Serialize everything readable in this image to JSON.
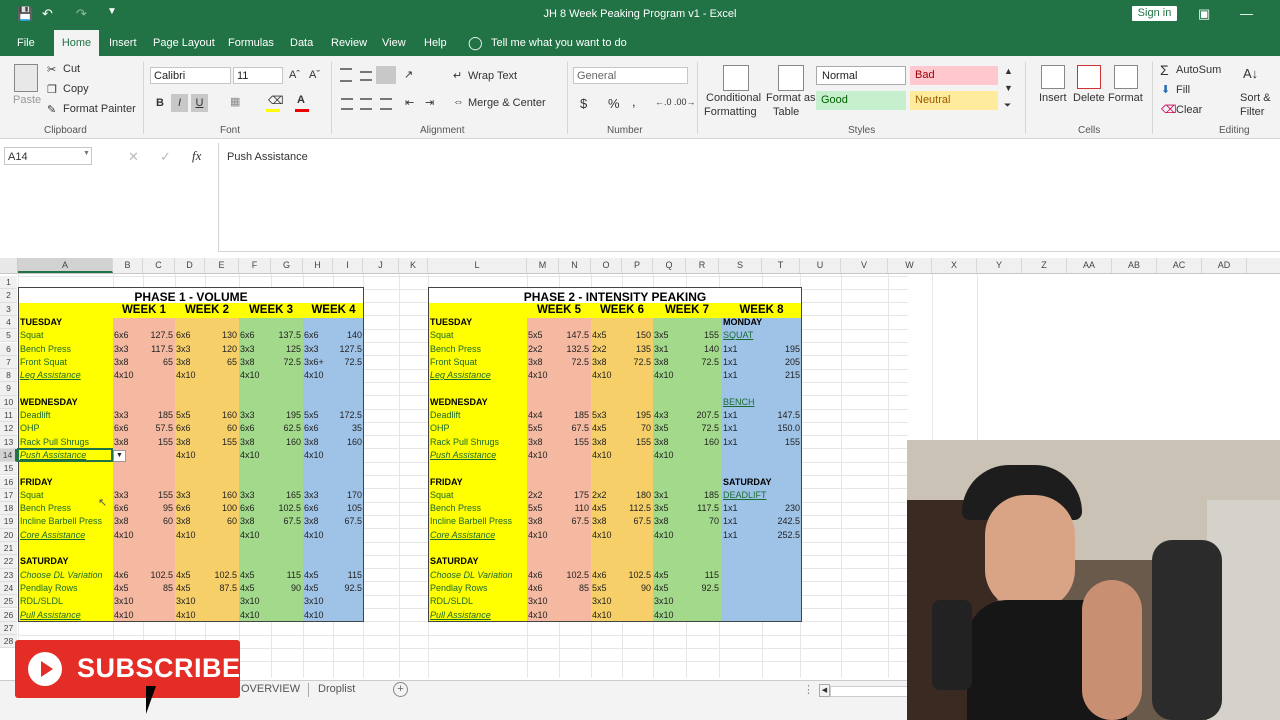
{
  "window": {
    "title": "JH 8 Week Peaking Program v1  -  Excel",
    "sign_in": "Sign in"
  },
  "menu": {
    "items": [
      "File",
      "Home",
      "Insert",
      "Page Layout",
      "Formulas",
      "Data",
      "Review",
      "View",
      "Help"
    ],
    "active": "Home",
    "tell_me": "Tell me what you want to do"
  },
  "ribbon": {
    "clipboard": {
      "paste": "Paste",
      "cut": "Cut",
      "copy": "Copy",
      "format_painter": "Format Painter",
      "label": "Clipboard"
    },
    "font": {
      "name": "Calibri",
      "size": "11",
      "bold": "B",
      "italic": "I",
      "underline": "U",
      "label": "Font"
    },
    "alignment": {
      "wrap": "Wrap Text",
      "merge": "Merge & Center",
      "label": "Alignment"
    },
    "number": {
      "format": "General",
      "currency": "$",
      "percent": "%",
      "comma": ",",
      "label": "Number"
    },
    "styles": {
      "conditional": "Conditional",
      "formatting": "Formatting",
      "format_as": "Format as",
      "table": "Table",
      "normal": "Normal",
      "bad": "Bad",
      "good": "Good",
      "neutral": "Neutral",
      "label": "Styles"
    },
    "cells": {
      "insert": "Insert",
      "delete": "Delete",
      "format": "Format",
      "label": "Cells"
    },
    "editing": {
      "autosum": "AutoSum",
      "fill": "Fill",
      "clear": "Clear",
      "sort": "Sort &",
      "filter": "Filter",
      "label": "Editing"
    }
  },
  "formula_bar": {
    "name_box": "A14",
    "fx": "fx",
    "content": "Push Assistance"
  },
  "columns": [
    "A",
    "B",
    "C",
    "D",
    "E",
    "F",
    "G",
    "H",
    "I",
    "J",
    "K",
    "L",
    "M",
    "N",
    "O",
    "P",
    "Q",
    "R",
    "S",
    "T",
    "U",
    "V",
    "W",
    "X",
    "Y",
    "Z",
    "AA",
    "AB",
    "AC",
    "AD",
    "AE"
  ],
  "rows": [
    "1",
    "2",
    "3",
    "4",
    "5",
    "6",
    "7",
    "8",
    "9",
    "10",
    "11",
    "12",
    "13",
    "14",
    "15",
    "16",
    "17",
    "18",
    "19",
    "20",
    "21",
    "22",
    "23",
    "24",
    "25",
    "26",
    "27",
    "28"
  ],
  "phase1": {
    "title": "PHASE 1 - VOLUME",
    "weeks": [
      "WEEK 1",
      "WEEK 2",
      "WEEK 3",
      "WEEK 4"
    ],
    "rows": [
      {
        "r": 4,
        "label": "TUESDAY",
        "style": "bold",
        "vals": []
      },
      {
        "r": 5,
        "label": "Squat",
        "vals": [
          "6x6",
          "127.5",
          "6x6",
          "130",
          "6x6",
          "137.5",
          "6x6",
          "140"
        ]
      },
      {
        "r": 6,
        "label": "Bench Press",
        "vals": [
          "3x3",
          "117.5",
          "3x3",
          "120",
          "3x3",
          "125",
          "3x3",
          "127.5"
        ]
      },
      {
        "r": 7,
        "label": "Front Squat",
        "vals": [
          "3x8",
          "65",
          "3x8",
          "65",
          "3x8",
          "72.5",
          "3x6+",
          "72.5"
        ]
      },
      {
        "r": 8,
        "label": "Leg Assistance",
        "style": "italu",
        "vals": [
          "4x10",
          "",
          "4x10",
          "",
          "4x10",
          "",
          "4x10",
          ""
        ]
      },
      {
        "r": 10,
        "label": "WEDNESDAY",
        "style": "bold",
        "vals": []
      },
      {
        "r": 11,
        "label": "Deadlift",
        "vals": [
          "3x3",
          "185",
          "5x5",
          "160",
          "3x3",
          "195",
          "5x5",
          "172.5"
        ]
      },
      {
        "r": 12,
        "label": "OHP",
        "vals": [
          "6x6",
          "57.5",
          "6x6",
          "60",
          "6x6",
          "62.5",
          "6x6",
          "35"
        ]
      },
      {
        "r": 13,
        "label": "Rack Pull Shrugs",
        "vals": [
          "3x8",
          "155",
          "3x8",
          "155",
          "3x8",
          "160",
          "3x8",
          "160"
        ]
      },
      {
        "r": 14,
        "label": "Push Assistance",
        "style": "italu",
        "vals": [
          "10",
          "",
          "4x10",
          "",
          "4x10",
          "",
          "4x10",
          ""
        ]
      },
      {
        "r": 16,
        "label": "FRIDAY",
        "style": "bold",
        "vals": []
      },
      {
        "r": 17,
        "label": "Squat",
        "vals": [
          "3x3",
          "155",
          "3x3",
          "160",
          "3x3",
          "165",
          "3x3",
          "170"
        ]
      },
      {
        "r": 18,
        "label": "Bench Press",
        "vals": [
          "6x6",
          "95",
          "6x6",
          "100",
          "6x6",
          "102.5",
          "6x6",
          "105"
        ]
      },
      {
        "r": 19,
        "label": "Incline Barbell Press",
        "vals": [
          "3x8",
          "60",
          "3x8",
          "60",
          "3x8",
          "67.5",
          "3x8",
          "67.5"
        ]
      },
      {
        "r": 20,
        "label": "Core Assistance",
        "style": "italu",
        "vals": [
          "4x10",
          "",
          "4x10",
          "",
          "4x10",
          "",
          "4x10",
          ""
        ]
      },
      {
        "r": 22,
        "label": "SATURDAY",
        "style": "bold",
        "vals": []
      },
      {
        "r": 23,
        "label": "Choose DL Variation",
        "style": "ital",
        "vals": [
          "4x6",
          "102.5",
          "4x5",
          "102.5",
          "4x5",
          "115",
          "4x5",
          "115"
        ]
      },
      {
        "r": 24,
        "label": "Pendlay Rows",
        "vals": [
          "4x5",
          "85",
          "4x5",
          "87.5",
          "4x5",
          "90",
          "4x5",
          "92.5"
        ]
      },
      {
        "r": 25,
        "label": "RDL/SLDL",
        "vals": [
          "3x10",
          "",
          "3x10",
          "",
          "3x10",
          "",
          "3x10",
          ""
        ]
      },
      {
        "r": 26,
        "label": "Pull Assistance",
        "style": "italu",
        "vals": [
          "4x10",
          "",
          "4x10",
          "",
          "4x10",
          "",
          "4x10",
          ""
        ]
      }
    ]
  },
  "phase2": {
    "title": "PHASE 2 - INTENSITY PEAKING",
    "weeks": [
      "WEEK 5",
      "WEEK 6",
      "WEEK 7",
      "WEEK 8"
    ],
    "rows": [
      {
        "r": 4,
        "label": "TUESDAY",
        "style": "bold",
        "vals": [],
        "w8": [
          "MONDAY",
          ""
        ],
        "w8style": "bold"
      },
      {
        "r": 5,
        "label": "Squat",
        "vals": [
          "5x5",
          "147.5",
          "4x5",
          "150",
          "3x5",
          "155"
        ],
        "w8": [
          "SQUAT",
          ""
        ],
        "w8style": "under"
      },
      {
        "r": 6,
        "label": "Bench Press",
        "vals": [
          "2x2",
          "132.5",
          "2x2",
          "135",
          "3x1",
          "140"
        ],
        "w8": [
          "1x1",
          "195"
        ]
      },
      {
        "r": 7,
        "label": "Front Squat",
        "vals": [
          "3x8",
          "72.5",
          "3x8",
          "72.5",
          "3x8",
          "72.5"
        ],
        "w8": [
          "1x1",
          "205"
        ]
      },
      {
        "r": 8,
        "label": "Leg Assistance",
        "style": "italu",
        "vals": [
          "4x10",
          "",
          "4x10",
          "",
          "4x10",
          ""
        ],
        "w8": [
          "1x1",
          "215"
        ]
      },
      {
        "r": 10,
        "label": "WEDNESDAY",
        "style": "bold",
        "vals": [],
        "w8": [
          "BENCH",
          ""
        ],
        "w8style": "under"
      },
      {
        "r": 11,
        "label": "Deadlift",
        "vals": [
          "4x4",
          "185",
          "5x3",
          "195",
          "4x3",
          "207.5"
        ],
        "w8": [
          "1x1",
          "147.5"
        ]
      },
      {
        "r": 12,
        "label": "OHP",
        "vals": [
          "5x5",
          "67.5",
          "4x5",
          "70",
          "3x5",
          "72.5"
        ],
        "w8": [
          "1x1",
          "150.0"
        ]
      },
      {
        "r": 13,
        "label": "Rack Pull Shrugs",
        "vals": [
          "3x8",
          "155",
          "3x8",
          "155",
          "3x8",
          "160"
        ],
        "w8": [
          "1x1",
          "155"
        ]
      },
      {
        "r": 14,
        "label": "Push Assistance",
        "style": "italu",
        "vals": [
          "4x10",
          "",
          "4x10",
          "",
          "4x10",
          ""
        ],
        "w8": [
          "",
          ""
        ]
      },
      {
        "r": 16,
        "label": "FRIDAY",
        "style": "bold",
        "vals": [],
        "w8": [
          "SATURDAY",
          ""
        ],
        "w8style": "bold"
      },
      {
        "r": 17,
        "label": "Squat",
        "vals": [
          "2x2",
          "175",
          "2x2",
          "180",
          "3x1",
          "185"
        ],
        "w8": [
          "DEADLIFT",
          ""
        ],
        "w8style": "under"
      },
      {
        "r": 18,
        "label": "Bench Press",
        "vals": [
          "5x5",
          "110",
          "4x5",
          "112.5",
          "3x5",
          "117.5"
        ],
        "w8": [
          "1x1",
          "230"
        ]
      },
      {
        "r": 19,
        "label": "Incline Barbell Press",
        "vals": [
          "3x8",
          "67.5",
          "3x8",
          "67.5",
          "3x8",
          "70"
        ],
        "w8": [
          "1x1",
          "242.5"
        ]
      },
      {
        "r": 20,
        "label": "Core Assistance",
        "style": "italu",
        "vals": [
          "4x10",
          "",
          "4x10",
          "",
          "4x10",
          ""
        ],
        "w8": [
          "1x1",
          "252.5"
        ]
      },
      {
        "r": 22,
        "label": "SATURDAY",
        "style": "bold",
        "vals": [],
        "w8": [
          "",
          ""
        ]
      },
      {
        "r": 23,
        "label": "Choose DL Variation",
        "style": "ital",
        "vals": [
          "4x6",
          "102.5",
          "4x6",
          "102.5",
          "4x5",
          "115"
        ],
        "w8": [
          "",
          ""
        ]
      },
      {
        "r": 24,
        "label": "Pendlay Rows",
        "vals": [
          "4x6",
          "85",
          "5x5",
          "90",
          "4x5",
          "92.5"
        ],
        "w8": [
          "",
          ""
        ]
      },
      {
        "r": 25,
        "label": "RDL/SLDL",
        "vals": [
          "3x10",
          "",
          "3x10",
          "",
          "3x10",
          ""
        ],
        "w8": [
          "",
          ""
        ]
      },
      {
        "r": 26,
        "label": "Pull Assistance",
        "style": "italu",
        "vals": [
          "4x10",
          "",
          "4x10",
          "",
          "4x10",
          ""
        ],
        "w8": [
          "",
          ""
        ]
      }
    ]
  },
  "sheet_tabs": {
    "overview": "OVERVIEW",
    "droplist": "Droplist"
  },
  "overlay": {
    "subscribe": "SUBSCRIBE"
  },
  "colors": {
    "excel_green": "#217346",
    "yellow": "#ffff00",
    "salmon": "#f4b9a0",
    "orange": "#f7cf68",
    "green": "#a3d98b",
    "blue": "#9fc3e7",
    "subscribe_red": "#e52d27"
  }
}
